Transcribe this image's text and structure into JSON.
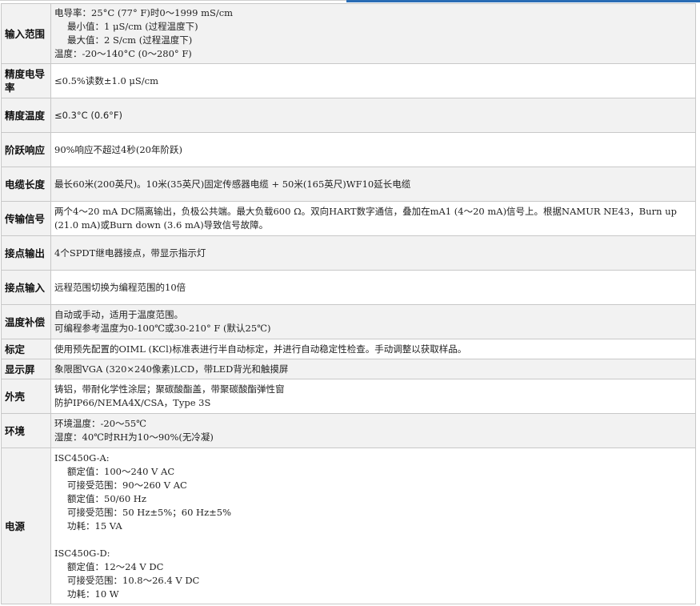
{
  "rows": [
    {
      "label": "输入范围",
      "lines": [
        "电导率：25°C (77° F)时0～1999 mS/cm",
        "最小值：1 μS/cm (过程温度下)",
        "最大值：2 S/cm (过程温度下)",
        "温度：-20～140°C (0～280° F)"
      ]
    },
    {
      "label": "精度电导率",
      "lines": [
        "≤0.5%读数±1.0 μS/cm"
      ]
    },
    {
      "label": "精度温度",
      "lines": [
        "≤0.3°C (0.6°F)"
      ]
    },
    {
      "label": "阶跃响应",
      "lines": [
        "90%响应不超过4秒(20年阶跃)"
      ]
    },
    {
      "label": "电缆长度",
      "lines": [
        "最长60米(200英尺)。10米(35英尺)固定传感器电缆 + 50米(165英尺)WF10延长电缆"
      ]
    },
    {
      "label": "传输信号",
      "lines": [
        "两个4～20 mA DC隔离输出，负极公共端。最大负载600 Ω。双向HART数字通信，叠加在mA1 (4～20 mA)信号上。根据NAMUR NE43，Burn up",
        "(21.0 mA)或Burn down (3.6 mA)导致信号故障。"
      ]
    },
    {
      "label": "接点输出",
      "lines": [
        "4个SPDT继电器接点，带显示指示灯"
      ]
    },
    {
      "label": "接点输入",
      "lines": [
        "远程范围切换为编程范围的10倍"
      ]
    },
    {
      "label": "温度补偿",
      "lines": [
        "自动或手动，适用于温度范围。",
        "可编程参考温度为0-100℃或30-210° F (默认25℃)"
      ]
    },
    {
      "label": "标定",
      "lines": [
        "使用预先配置的OIML (KCl)标准表进行半自动标定，并进行自动稳定性检查。手动调整以获取样品。"
      ]
    },
    {
      "label": "显示屏",
      "lines": [
        "象限图VGA (320×240像素)LCD，带LED背光和触摸屏"
      ]
    },
    {
      "label": "外壳",
      "lines": [
        "铸铝，带耐化学性涂层；聚碳酸酯盖，带聚碳酸酯弹性窗",
        "防护IP66/NEMA4X/CSA，Type 3S"
      ]
    },
    {
      "label": "环境",
      "lines": [
        "环境温度：-20～55℃",
        "湿度：40℃时RH为10～90%(无冷凝)"
      ]
    },
    {
      "label": "电源",
      "lines": [
        "ISC450G-A:",
        "额定值：100～240 V AC",
        "可接受范围：90～260 V AC",
        "额定值：50/60 Hz",
        "可接受范围：50 Hz±5%；60 Hz±5%",
        "功耗：15 VA",
        "",
        "ISC450G-D:",
        "额定值：12～24 V DC",
        "可接受范围：10.8～26.4 V DC",
        "功耗：10 W"
      ]
    }
  ]
}
